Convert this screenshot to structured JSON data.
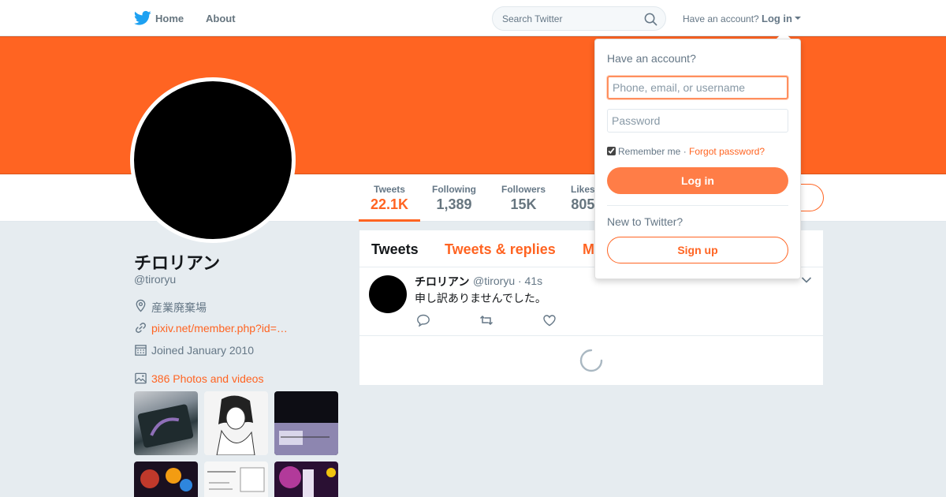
{
  "colors": {
    "accent": "#ff6422",
    "text": "#14171a",
    "muted": "#657786",
    "background": "#e6ecf0"
  },
  "topnav": {
    "logo_icon": "twitter-bird-icon",
    "home_label": "Home",
    "about_label": "About",
    "search": {
      "placeholder": "Search Twitter",
      "value": ""
    },
    "have_account": "Have an account?",
    "login_label": "Log in"
  },
  "profile": {
    "name": "チロリアン",
    "handle": "@tiroryu",
    "location": "産業廃棄場",
    "website": "pixiv.net/member.php?id=…",
    "joined": "Joined January 2010",
    "media_link": "386 Photos and videos"
  },
  "stats": [
    {
      "label": "Tweets",
      "value": "22.1K",
      "active": true
    },
    {
      "label": "Following",
      "value": "1,389"
    },
    {
      "label": "Followers",
      "value": "15K"
    },
    {
      "label": "Likes",
      "value": "805"
    }
  ],
  "timeline": {
    "tabs": [
      "Tweets",
      "Tweets & replies",
      "M"
    ],
    "tweet": {
      "name": "チロリアン",
      "handle": "@tiroryu",
      "time": "· 41s",
      "text": "申し訳ありませんでした。"
    }
  },
  "login_dropdown": {
    "title": "Have an account?",
    "username_placeholder": "Phone, email, or username",
    "password_placeholder": "Password",
    "remember_label": "Remember me",
    "remember_checked": true,
    "separator": "·",
    "forgot_label": "Forgot password?",
    "login_button": "Log in",
    "new_label": "New to Twitter?",
    "signup_button": "Sign up"
  }
}
